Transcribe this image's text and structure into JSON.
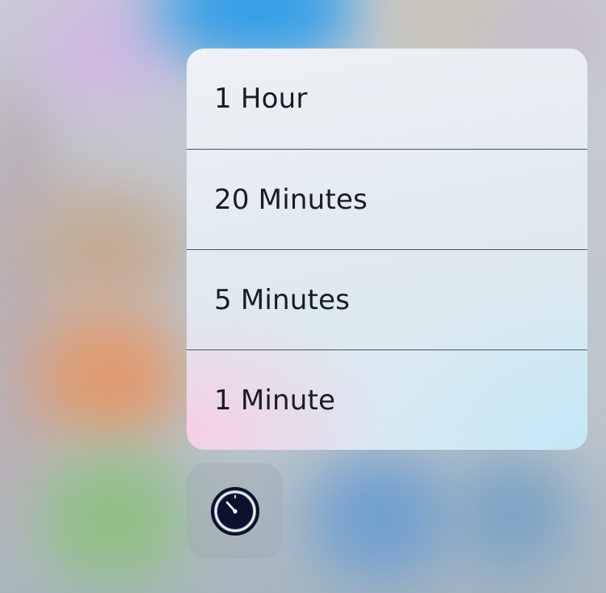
{
  "quick_actions": {
    "items": [
      {
        "label": "1 Hour"
      },
      {
        "label": "20 Minutes"
      },
      {
        "label": "5 Minutes"
      },
      {
        "label": "1 Minute"
      }
    ]
  },
  "app_icon": {
    "icon": "timer-icon",
    "color": "#0b1230"
  }
}
